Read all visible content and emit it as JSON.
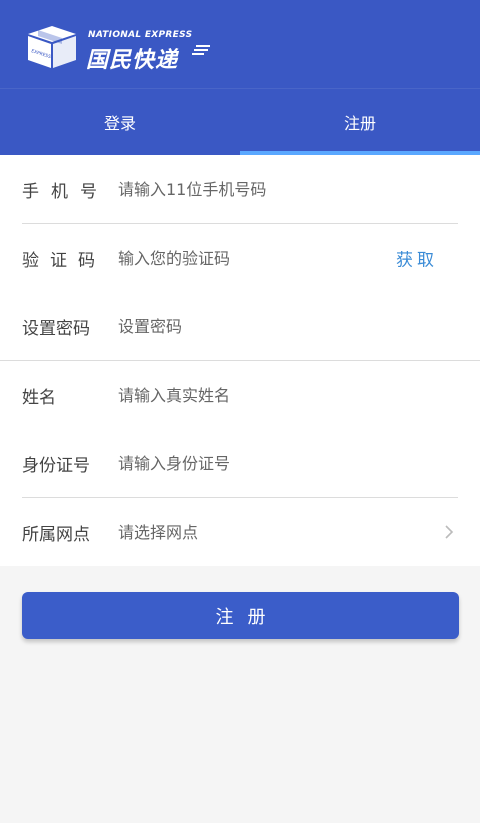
{
  "brand": {
    "english_name": "NATIONAL EXPRESS",
    "chinese_name": "国民快递",
    "box_text": "EXPRESS"
  },
  "tabs": [
    {
      "label": "登录",
      "active": false
    },
    {
      "label": "注册",
      "active": true
    }
  ],
  "form": {
    "phone": {
      "label": "手机号",
      "placeholder": "请输入11位手机号码"
    },
    "code": {
      "label": "验证码",
      "placeholder": "输入您的验证码",
      "action": "获取"
    },
    "password": {
      "label": "设置密码",
      "placeholder": "设置密码"
    },
    "name": {
      "label": "姓名",
      "placeholder": "请输入真实姓名"
    },
    "id_number": {
      "label": "身份证号",
      "placeholder": "请输入身份证号"
    },
    "branch": {
      "label": "所属网点",
      "placeholder": "请选择网点"
    }
  },
  "submit_label": "注册",
  "colors": {
    "header": "#3a58c4",
    "tab_indicator": "#5aa8ff",
    "button": "#3b5dc9",
    "link": "#3a8bd6"
  }
}
